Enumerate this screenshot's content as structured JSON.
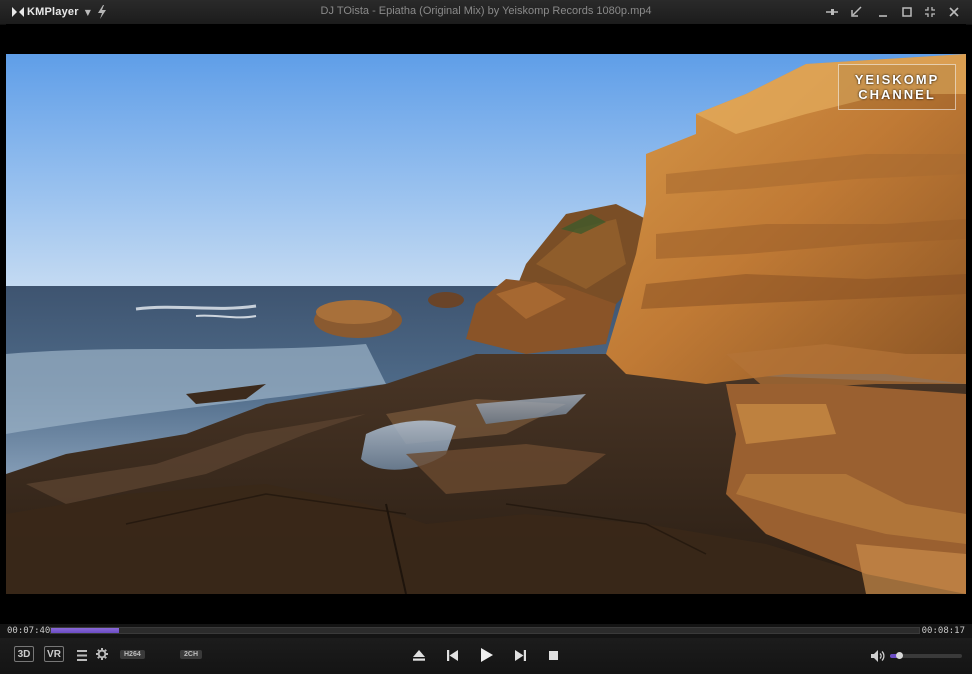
{
  "app": {
    "name": "KMPlayer",
    "window_title": "DJ TOista - Epiatha (Original Mix) by Yeiskomp Records    1080p.mp4"
  },
  "video": {
    "watermark_line1": "YEISKOMP",
    "watermark_line2": "CHANNEL"
  },
  "playback": {
    "current_time": "00:07:40",
    "total_time": "00:08:17",
    "progress": 0.078,
    "volume": 0.12
  },
  "controls": {
    "badge_3d": "3D",
    "badge_vr": "VR",
    "codec": "H264",
    "channels": "2CH"
  },
  "colors": {
    "accent": "#6b4cc4",
    "titlebar": "#222222",
    "text": "#c8c8c8"
  },
  "icons": [
    "kmplayer-logo-icon",
    "chevron-down-icon",
    "bolt-icon",
    "pin-icon",
    "compact-mode-icon",
    "minimize-icon",
    "maximize-icon",
    "fullscreen-icon",
    "close-icon",
    "playlist-icon",
    "gear-icon",
    "eject-icon",
    "previous-icon",
    "play-icon",
    "next-icon",
    "stop-icon",
    "speaker-icon"
  ]
}
